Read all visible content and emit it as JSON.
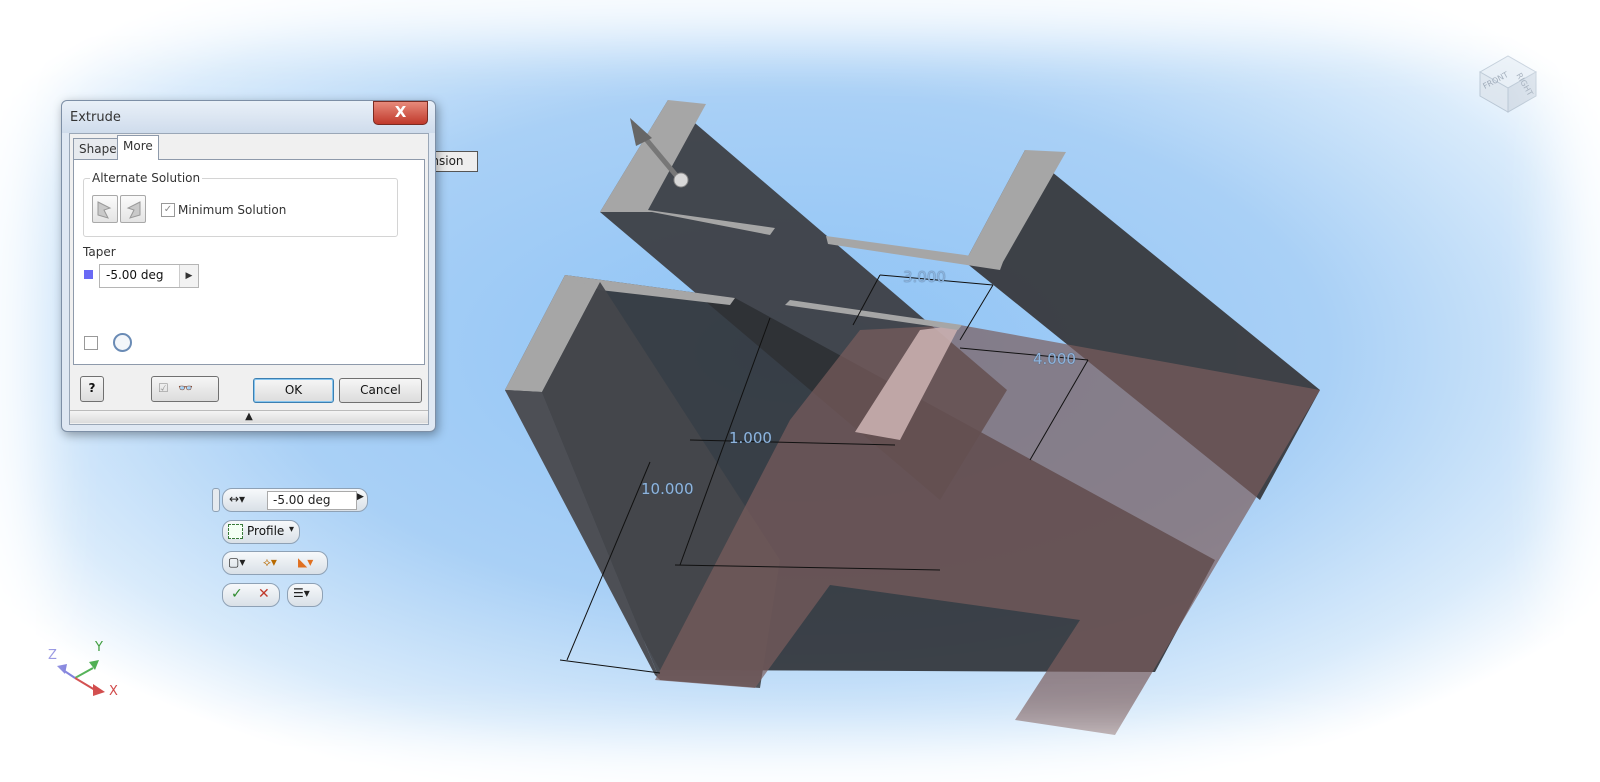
{
  "dialog": {
    "title": "Extrude",
    "close_glyph": "X",
    "tabs": [
      "Shape",
      "More"
    ],
    "active_tab": "More",
    "alternate_solution_label": "Alternate Solution",
    "minimum_solution_label": "Minimum Solution",
    "minimum_solution_checked": true,
    "taper_label": "Taper",
    "taper_value": "-5.00 deg",
    "ok_label": "OK",
    "cancel_label": "Cancel"
  },
  "tooltip_text": "ension",
  "minitoolbar": {
    "taper_value": "-5.00 deg",
    "profile_label": "Profile"
  },
  "dimensions": [
    "3.000",
    "4.000",
    "1.000",
    "10.000"
  ],
  "view_cube": {
    "front": "FRONT",
    "right": "RIGHT"
  },
  "axes": {
    "x": "X",
    "y": "Y",
    "z": "Z"
  },
  "colors": {
    "sky": "#8ec3f5",
    "part_dark": "#3d3f44",
    "part_face": "#6d5659",
    "part_top": "#a6a6a6",
    "accent_blue": "#6a6af5"
  }
}
